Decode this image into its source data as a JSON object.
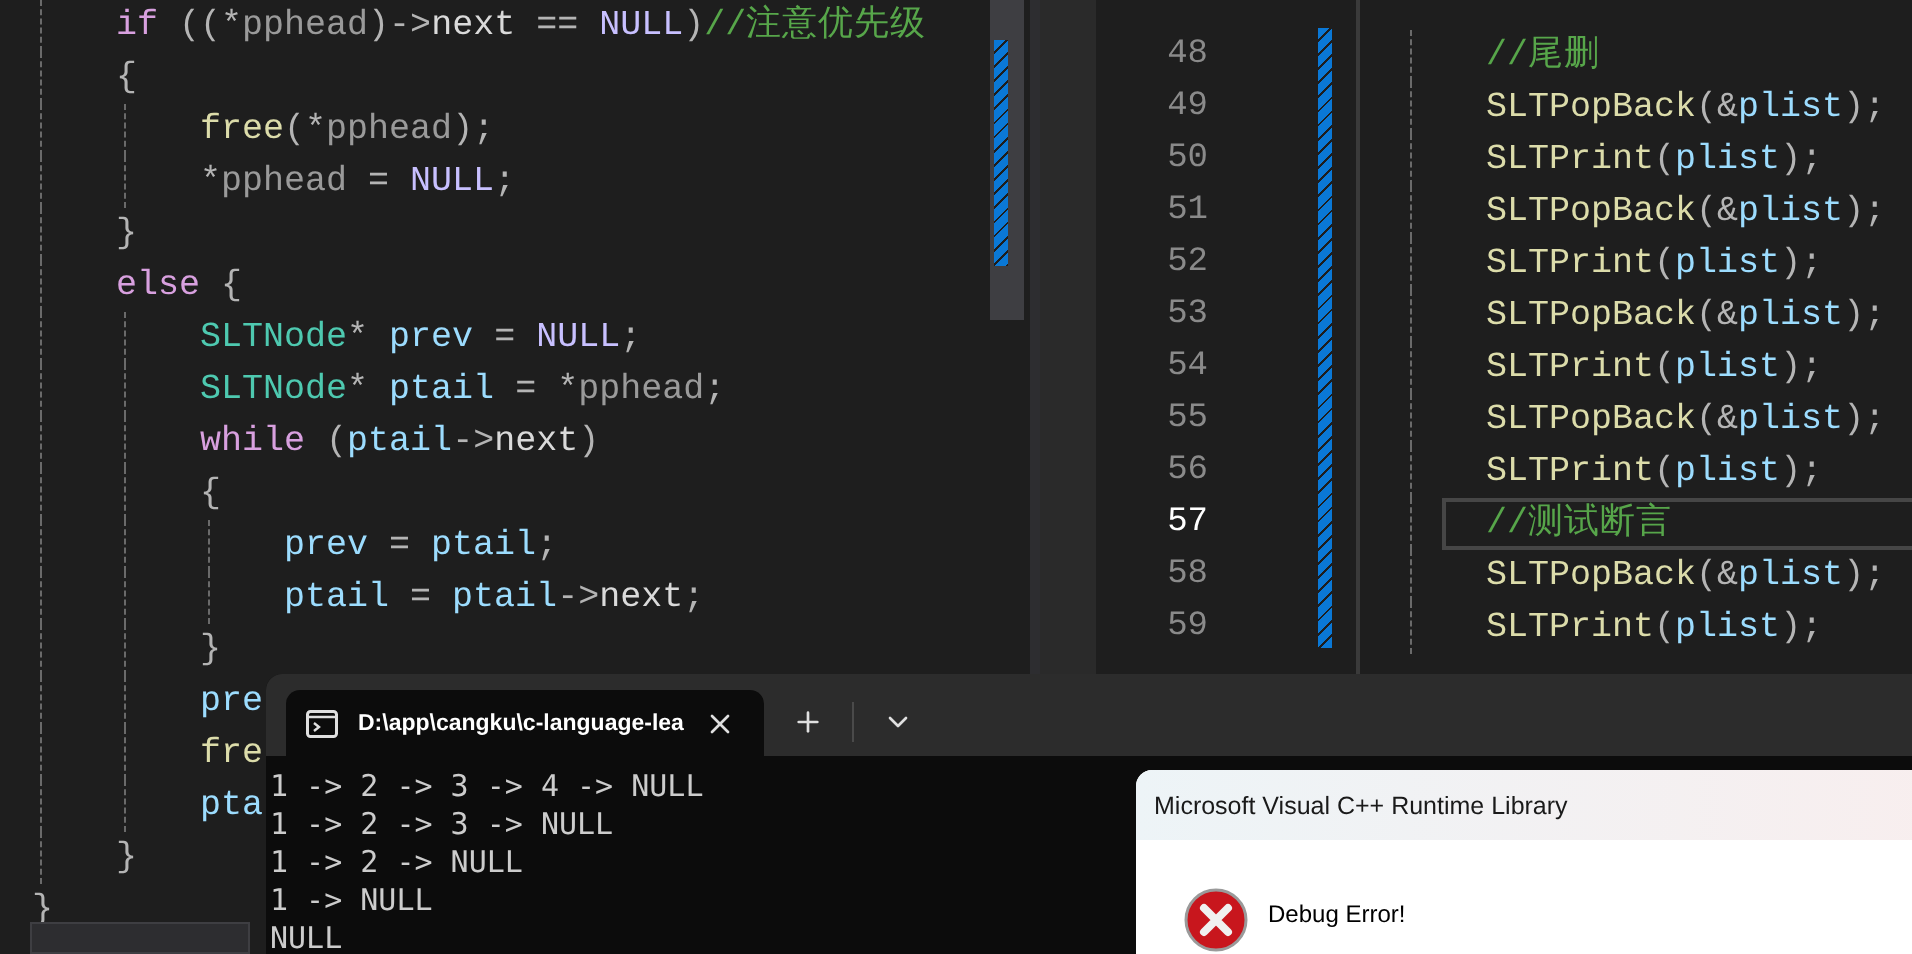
{
  "editor_left": {
    "lines": [
      {
        "tokens": [
          {
            "text": "    if",
            "kind": "kw"
          },
          {
            "text": " ((*",
            "kind": "punct"
          },
          {
            "text": "pphead",
            "kind": "param"
          },
          {
            "text": ")->",
            "kind": "punct"
          },
          {
            "text": "next",
            "kind": "member"
          },
          {
            "text": " == ",
            "kind": "punct"
          },
          {
            "text": "NULL",
            "kind": "macro"
          },
          {
            "text": ")",
            "kind": "punct"
          },
          {
            "text": "//注意优先级",
            "kind": "comment"
          }
        ]
      },
      {
        "tokens": [
          {
            "text": "    {",
            "kind": "punct"
          }
        ]
      },
      {
        "tokens": [
          {
            "text": "        free",
            "kind": "fn"
          },
          {
            "text": "(*",
            "kind": "punct"
          },
          {
            "text": "pphead",
            "kind": "param"
          },
          {
            "text": ");",
            "kind": "punct"
          }
        ]
      },
      {
        "tokens": [
          {
            "text": "        *",
            "kind": "punct"
          },
          {
            "text": "pphead",
            "kind": "param"
          },
          {
            "text": " = ",
            "kind": "punct"
          },
          {
            "text": "NULL",
            "kind": "macro"
          },
          {
            "text": ";",
            "kind": "punct"
          }
        ]
      },
      {
        "tokens": [
          {
            "text": "    }",
            "kind": "punct"
          }
        ]
      },
      {
        "tokens": [
          {
            "text": "    else",
            "kind": "kw"
          },
          {
            "text": " {",
            "kind": "punct"
          }
        ]
      },
      {
        "tokens": [
          {
            "text": "        SLTNode",
            "kind": "type"
          },
          {
            "text": "* ",
            "kind": "punct"
          },
          {
            "text": "prev",
            "kind": "var"
          },
          {
            "text": " = ",
            "kind": "punct"
          },
          {
            "text": "NULL",
            "kind": "macro"
          },
          {
            "text": ";",
            "kind": "punct"
          }
        ]
      },
      {
        "tokens": [
          {
            "text": "        SLTNode",
            "kind": "type"
          },
          {
            "text": "* ",
            "kind": "punct"
          },
          {
            "text": "ptail",
            "kind": "var"
          },
          {
            "text": " = *",
            "kind": "punct"
          },
          {
            "text": "pphead",
            "kind": "param"
          },
          {
            "text": ";",
            "kind": "punct"
          }
        ]
      },
      {
        "tokens": [
          {
            "text": "        while",
            "kind": "kw"
          },
          {
            "text": " (",
            "kind": "punct"
          },
          {
            "text": "ptail",
            "kind": "var"
          },
          {
            "text": "->",
            "kind": "punct"
          },
          {
            "text": "next",
            "kind": "member"
          },
          {
            "text": ")",
            "kind": "punct"
          }
        ]
      },
      {
        "tokens": [
          {
            "text": "        {",
            "kind": "punct"
          }
        ]
      },
      {
        "tokens": [
          {
            "text": "            prev",
            "kind": "var"
          },
          {
            "text": " = ",
            "kind": "punct"
          },
          {
            "text": "ptail",
            "kind": "var"
          },
          {
            "text": ";",
            "kind": "punct"
          }
        ]
      },
      {
        "tokens": [
          {
            "text": "            ptail",
            "kind": "var"
          },
          {
            "text": " = ",
            "kind": "punct"
          },
          {
            "text": "ptail",
            "kind": "var"
          },
          {
            "text": "->",
            "kind": "punct"
          },
          {
            "text": "next",
            "kind": "member"
          },
          {
            "text": ";",
            "kind": "punct"
          }
        ]
      },
      {
        "tokens": [
          {
            "text": "        }",
            "kind": "punct"
          }
        ]
      },
      {
        "tokens": [
          {
            "text": "        pre",
            "kind": "var"
          }
        ]
      },
      {
        "tokens": [
          {
            "text": "        fre",
            "kind": "fn"
          }
        ]
      },
      {
        "tokens": [
          {
            "text": "        pta",
            "kind": "var"
          }
        ]
      },
      {
        "tokens": [
          {
            "text": "    }",
            "kind": "punct"
          }
        ]
      },
      {
        "tokens": [
          {
            "text": "}",
            "kind": "punct"
          }
        ]
      }
    ]
  },
  "editor_right": {
    "lines": [
      {
        "number": "48",
        "current": false,
        "tokens": [
          {
            "text": "    //尾删",
            "kind": "comment"
          }
        ]
      },
      {
        "number": "49",
        "current": false,
        "tokens": [
          {
            "text": "    SLTPopBack",
            "kind": "fn"
          },
          {
            "text": "(&",
            "kind": "punct"
          },
          {
            "text": "plist",
            "kind": "var"
          },
          {
            "text": ");",
            "kind": "punct"
          }
        ]
      },
      {
        "number": "50",
        "current": false,
        "tokens": [
          {
            "text": "    SLTPrint",
            "kind": "fn"
          },
          {
            "text": "(",
            "kind": "punct"
          },
          {
            "text": "plist",
            "kind": "var"
          },
          {
            "text": ");",
            "kind": "punct"
          }
        ]
      },
      {
        "number": "51",
        "current": false,
        "tokens": [
          {
            "text": "    SLTPopBack",
            "kind": "fn"
          },
          {
            "text": "(&",
            "kind": "punct"
          },
          {
            "text": "plist",
            "kind": "var"
          },
          {
            "text": ");",
            "kind": "punct"
          }
        ]
      },
      {
        "number": "52",
        "current": false,
        "tokens": [
          {
            "text": "    SLTPrint",
            "kind": "fn"
          },
          {
            "text": "(",
            "kind": "punct"
          },
          {
            "text": "plist",
            "kind": "var"
          },
          {
            "text": ");",
            "kind": "punct"
          }
        ]
      },
      {
        "number": "53",
        "current": false,
        "tokens": [
          {
            "text": "    SLTPopBack",
            "kind": "fn"
          },
          {
            "text": "(&",
            "kind": "punct"
          },
          {
            "text": "plist",
            "kind": "var"
          },
          {
            "text": ");",
            "kind": "punct"
          }
        ]
      },
      {
        "number": "54",
        "current": false,
        "tokens": [
          {
            "text": "    SLTPrint",
            "kind": "fn"
          },
          {
            "text": "(",
            "kind": "punct"
          },
          {
            "text": "plist",
            "kind": "var"
          },
          {
            "text": ");",
            "kind": "punct"
          }
        ]
      },
      {
        "number": "55",
        "current": false,
        "tokens": [
          {
            "text": "    SLTPopBack",
            "kind": "fn"
          },
          {
            "text": "(&",
            "kind": "punct"
          },
          {
            "text": "plist",
            "kind": "var"
          },
          {
            "text": ");",
            "kind": "punct"
          }
        ]
      },
      {
        "number": "56",
        "current": false,
        "tokens": [
          {
            "text": "    SLTPrint",
            "kind": "fn"
          },
          {
            "text": "(",
            "kind": "punct"
          },
          {
            "text": "plist",
            "kind": "var"
          },
          {
            "text": ");",
            "kind": "punct"
          }
        ]
      },
      {
        "number": "57",
        "current": true,
        "tokens": [
          {
            "text": "    //测试断言",
            "kind": "comment"
          }
        ]
      },
      {
        "number": "58",
        "current": false,
        "tokens": [
          {
            "text": "    SLTPopBack",
            "kind": "fn"
          },
          {
            "text": "(&",
            "kind": "punct"
          },
          {
            "text": "plist",
            "kind": "var"
          },
          {
            "text": ");",
            "kind": "punct"
          }
        ]
      },
      {
        "number": "59",
        "current": false,
        "tokens": [
          {
            "text": "    SLTPrint",
            "kind": "fn"
          },
          {
            "text": "(",
            "kind": "punct"
          },
          {
            "text": "plist",
            "kind": "var"
          },
          {
            "text": ");",
            "kind": "punct"
          }
        ]
      }
    ]
  },
  "terminal": {
    "tab_title": "D:\\app\\cangku\\c-language-lea",
    "output": [
      "1 -> 2 -> 3 -> 4 -> NULL",
      "1 -> 2 -> 3 -> NULL",
      "1 -> 2 -> NULL",
      "1 -> NULL",
      "NULL"
    ]
  },
  "dialog": {
    "title": "Microsoft Visual C++ Runtime Library",
    "message": "Debug Error!"
  }
}
